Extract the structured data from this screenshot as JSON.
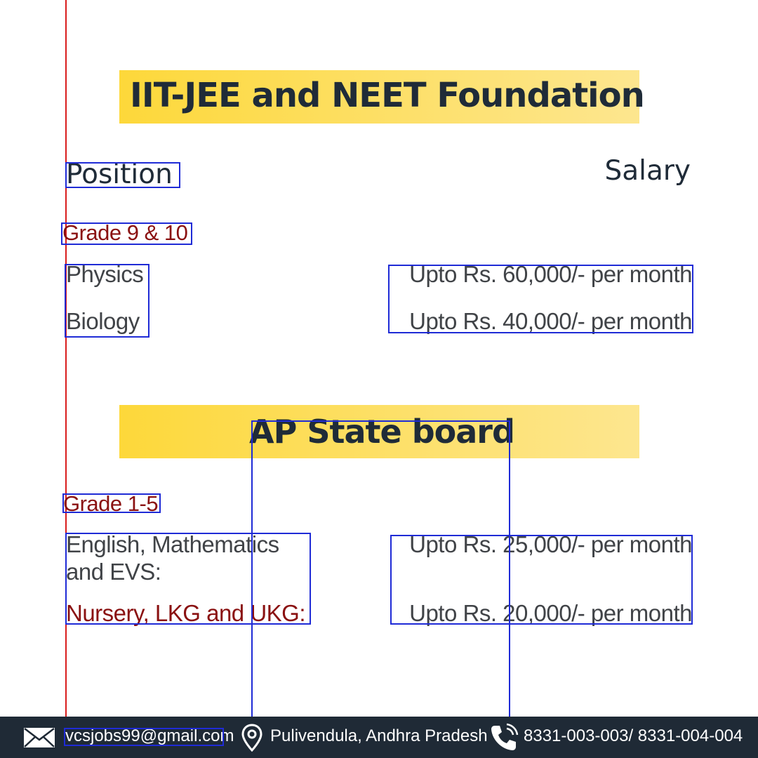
{
  "colors": {
    "banner_start": "#fdd83a",
    "banner_end": "#fde68f",
    "heading": "#1f2b38",
    "grade_text": "#8a1111",
    "body_text": "#404347",
    "footer_bg": "#1f2a36",
    "guide_line": "#d91d1d",
    "selection_outline": "#1f2bd6"
  },
  "section1": {
    "title": "IIT-JEE and NEET Foundation",
    "position_heading": "Position",
    "salary_heading": "Salary",
    "grade": "Grade 9 & 10",
    "rows": [
      {
        "subject": "Physics",
        "salary": "Upto Rs. 60,000/- per month"
      },
      {
        "subject": "Biology",
        "salary": "Upto Rs. 40,000/- per month"
      }
    ]
  },
  "section2": {
    "title": "AP State board",
    "grade": "Grade 1-5",
    "rows": [
      {
        "subject_line1": "English, Mathematics",
        "subject_line2": "and EVS:",
        "salary": "Upto Rs. 25,000/- per month"
      },
      {
        "subject": "Nursery, LKG and UKG:",
        "salary": "Upto Rs. 20,000/- per month"
      }
    ]
  },
  "footer": {
    "email_icon": "envelope-icon",
    "email": "vcsjobs99@gmail.com",
    "location_icon": "map-pin-icon",
    "location": "Pulivendula, Andhra Pradesh",
    "phone_icon": "phone-icon",
    "phone": "8331-003-003/ 8331-004-004"
  }
}
